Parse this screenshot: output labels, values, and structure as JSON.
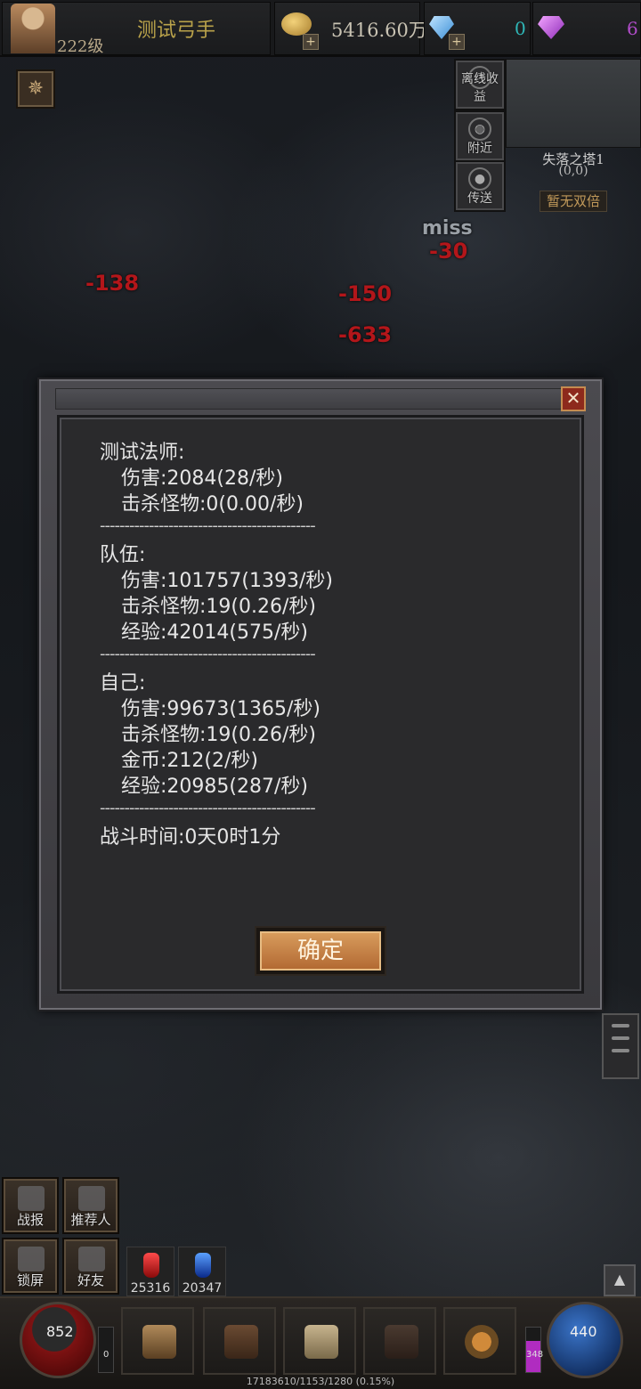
{
  "player": {
    "name": "测试弓手",
    "level": "222级"
  },
  "currency": {
    "gold": "5416.60万",
    "diamonds": "0",
    "gems": "6"
  },
  "side_buttons": {
    "offline": "离线收益",
    "nearby": "附近",
    "teleport": "传送"
  },
  "map": {
    "name": "失落之塔1",
    "coords": "(0,0)",
    "double_exp": "暂无双倍"
  },
  "combat": {
    "miss": "miss",
    "dmg1": "-30",
    "dmg2": "-138",
    "dmg3": "-150",
    "dmg4": "-633"
  },
  "report": {
    "mage_title": "测试法师:",
    "mage_damage": "伤害:2084(28/秒)",
    "mage_kills": "击杀怪物:0(0.00/秒)",
    "separator": "--------------------------------------------",
    "team_title": "队伍:",
    "team_damage": "伤害:101757(1393/秒)",
    "team_kills": "击杀怪物:19(0.26/秒)",
    "team_exp": "经验:42014(575/秒)",
    "self_title": "自己:",
    "self_damage": "伤害:99673(1365/秒)",
    "self_kills": "击杀怪物:19(0.26/秒)",
    "self_gold": "金币:212(2/秒)",
    "self_exp": "经验:20985(287/秒)",
    "battle_time": "战斗时间:0天0时1分",
    "ok": "确定"
  },
  "bottom_buttons": {
    "report": "战报",
    "referrer": "推荐人",
    "lock": "锁屏",
    "friends": "好友"
  },
  "potions": {
    "hp": "25316",
    "mp": "20347"
  },
  "hud": {
    "hp": "852",
    "mp": "440",
    "left_small": "0",
    "right_small": "348",
    "exp": "17183610/1153/1280 (0.15%)"
  }
}
